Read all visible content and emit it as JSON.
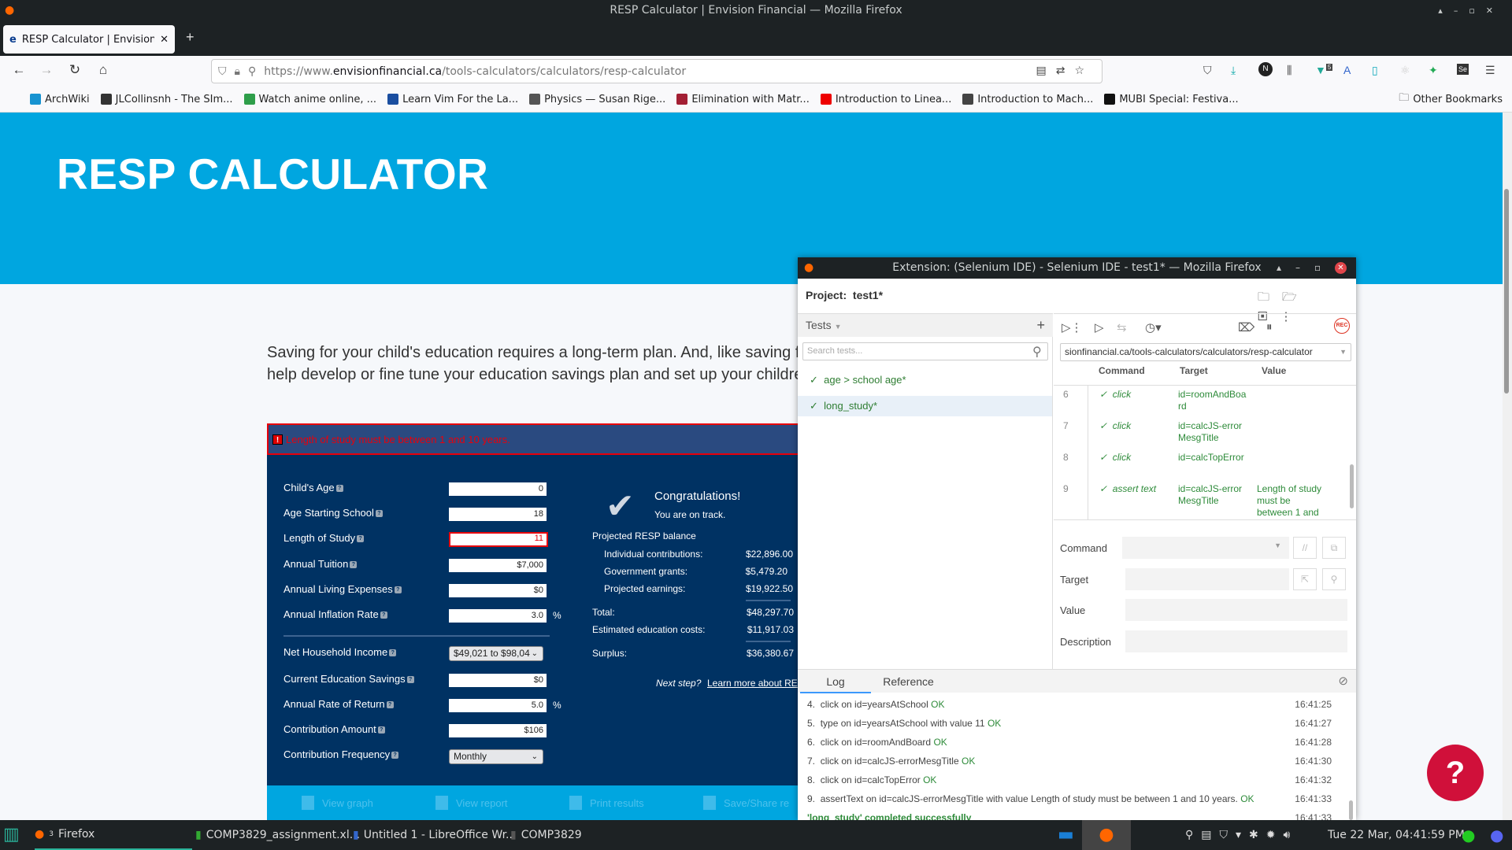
{
  "window": {
    "title": "RESP Calculator | Envision Financial — Mozilla Firefox"
  },
  "tab": {
    "label": "RESP Calculator | Envision",
    "favicon": "e"
  },
  "urlbar": {
    "prefix": "https://www.",
    "domain": "envisionfinancial.ca",
    "path": "/tools-calculators/calculators/resp-calculator"
  },
  "bookmarks": [
    {
      "label": "ArchWiki",
      "color": "#1793d1"
    },
    {
      "label": "JLCollinsnh - The SIm...",
      "color": "#333"
    },
    {
      "label": "Watch anime online, ...",
      "color": "#2e9e4a"
    },
    {
      "label": "Learn Vim For the La...",
      "color": "#1a4ea0"
    },
    {
      "label": "Physics — Susan Rige...",
      "color": "#555"
    },
    {
      "label": "Elimination with Matr...",
      "color": "#a31f34"
    },
    {
      "label": "Introduction to Linea...",
      "color": "#e00"
    },
    {
      "label": "Introduction to Mach...",
      "color": "#444"
    },
    {
      "label": "MUBI Special: Festiva...",
      "color": "#111"
    }
  ],
  "other_bookmarks": "Other Bookmarks",
  "extension_badge": "5",
  "page": {
    "title": "RESP CALCULATOR",
    "intro_line1": "Saving for your child's education requires a long-term plan. And, like saving for retirement",
    "intro_line2": "help develop or fine tune your education savings plan and set up your children for success"
  },
  "calculator": {
    "error": "Length of study must be between 1 and 10 years.",
    "fields": [
      {
        "label": "Child's Age",
        "value": "0"
      },
      {
        "label": "Age Starting School",
        "value": "18"
      },
      {
        "label": "Length of Study",
        "value": "11",
        "error": true
      },
      {
        "label": "Annual Tuition",
        "value": "$7,000"
      },
      {
        "label": "Annual Living Expenses",
        "value": "$0"
      },
      {
        "label": "Annual Inflation Rate",
        "value": "3.0",
        "unit": "%"
      }
    ],
    "fields2": [
      {
        "label": "Net Household Income",
        "value": "$49,021 to $98,04"
      },
      {
        "label": "Current Education Savings",
        "value": "$0"
      },
      {
        "label": "Annual Rate of Return",
        "value": "5.0",
        "unit": "%"
      },
      {
        "label": "Contribution Amount",
        "value": "$106"
      },
      {
        "label": "Contribution Frequency",
        "value": "Monthly"
      }
    ],
    "results": {
      "heading": "Congratulations!",
      "sub": "You are on track.",
      "projected_label": "Projected RESP balance",
      "individual_label": "Individual contributions:",
      "individual": "$22,896.00",
      "grants_label": "Government grants:",
      "grants": "$5,479.20",
      "earnings_label": "Projected earnings:",
      "earnings": "$19,922.50",
      "total_label": "Total:",
      "total": "$48,297.70",
      "costs_label": "Estimated education costs:",
      "costs": "$11,917.03",
      "surplus_label": "Surplus:",
      "surplus": "$36,380.67",
      "next_step": "Next step?",
      "learn_more": "Learn more about RE"
    },
    "footer": [
      "View graph",
      "View report",
      "Print results",
      "Save/Share re"
    ]
  },
  "selenium": {
    "title": "Extension: (Selenium IDE) - Selenium IDE - test1* — Mozilla Firefox",
    "project_label": "Project:",
    "project": "test1*",
    "tests_label": "Tests",
    "search_placeholder": "Search tests...",
    "tests": [
      {
        "name": "age > school age*"
      },
      {
        "name": "long_study*",
        "selected": true
      }
    ],
    "url": "sionfinancial.ca/tools-calculators/calculators/resp-calculator",
    "columns": [
      "Command",
      "Target",
      "Value"
    ],
    "rows": [
      {
        "n": "6",
        "command": "click",
        "target": "id=roomAndBoard",
        "value": ""
      },
      {
        "n": "7",
        "command": "click",
        "target": "id=calcJS-errorMesgTitle",
        "value": ""
      },
      {
        "n": "8",
        "command": "click",
        "target": "id=calcTopError",
        "value": ""
      },
      {
        "n": "9",
        "command": "assert text",
        "target": "id=calcJS-errorMesgTitle",
        "value": "Length of study must be between 1 and ..."
      }
    ],
    "form": {
      "command": "Command",
      "target": "Target",
      "value": "Value",
      "description": "Description"
    },
    "log_tab": "Log",
    "reference_tab": "Reference",
    "log": [
      {
        "n": "4.",
        "text": "click on id=yearsAtSchool",
        "status": "OK",
        "time": "16:41:25"
      },
      {
        "n": "5.",
        "text": "type on id=yearsAtSchool with value 11",
        "status": "OK",
        "time": "16:41:27"
      },
      {
        "n": "6.",
        "text": "click on id=roomAndBoard",
        "status": "OK",
        "time": "16:41:28"
      },
      {
        "n": "7.",
        "text": "click on id=calcJS-errorMesgTitle",
        "status": "OK",
        "time": "16:41:30"
      },
      {
        "n": "8.",
        "text": "click on id=calcTopError",
        "status": "OK",
        "time": "16:41:32"
      },
      {
        "n": "9.",
        "text": "assertText on id=calcJS-errorMesgTitle with value Length of study must be between 1 and 10 years.",
        "status": "OK",
        "time": "16:41:33"
      }
    ],
    "completed": "'long_study' completed successfully",
    "completed_time": "16:41:33"
  },
  "taskbar": {
    "items": [
      "Firefox",
      "COMP3829_assignment.xl...",
      "Untitled 1 - LibreOffice Wr...",
      "COMP3829"
    ],
    "firefox_count": "3",
    "clock": "Tue 22 Mar, 04:41:59 PM"
  }
}
